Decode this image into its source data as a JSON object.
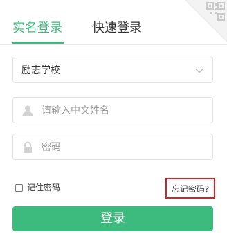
{
  "tabs": [
    {
      "label": "实名登录",
      "active": true
    },
    {
      "label": "快速登录",
      "active": false
    }
  ],
  "form": {
    "school_value": "励志学校",
    "name_placeholder": "请输入中文姓名",
    "password_placeholder": "密码",
    "remember_label": "记住密码",
    "forgot_label": "忘记密码?",
    "login_label": "登录"
  },
  "colors": {
    "accent": "#3dba7e",
    "highlight_border": "#e41b23"
  },
  "icons": {
    "qr": "qr-code-icon",
    "school_dropdown": "chevron-down-icon",
    "name": "user-icon",
    "password": "lock-icon"
  }
}
